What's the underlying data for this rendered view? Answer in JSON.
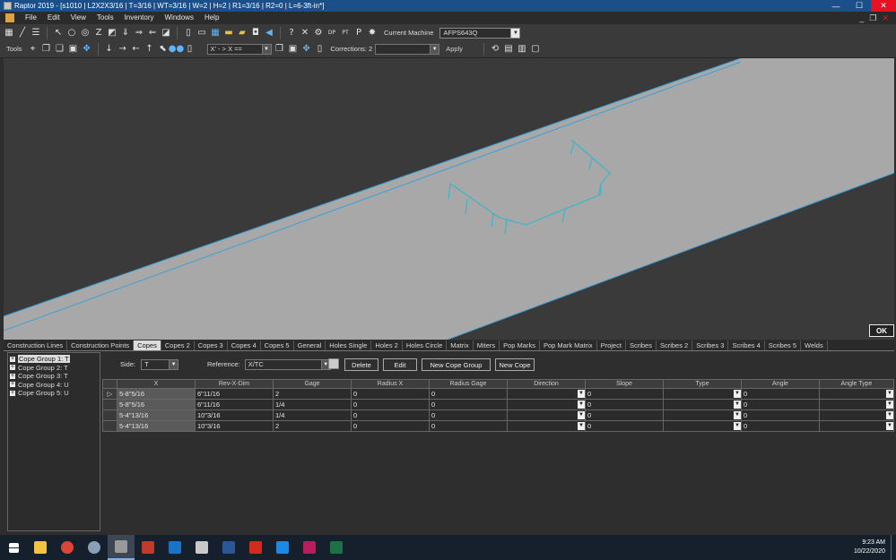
{
  "window": {
    "title": "Raptor 2019 - [s1010 | L2X2X3/16 | T=3/16 | WT=3/16 | W=2 | H=2 | R1=3/16 | R2=0 | L=6-3ft-in*]",
    "minimize_glyph": "—",
    "maximize_glyph": "☐",
    "close_glyph": "✕",
    "mdi_minimize_glyph": "_",
    "mdi_restore_glyph": "❐",
    "mdi_close_glyph": "✕"
  },
  "menu": [
    "File",
    "Edit",
    "View",
    "Tools",
    "Inventory",
    "Windows",
    "Help"
  ],
  "toolbar1": {
    "icons": [
      "grid-icon",
      "line-icon",
      "pointer-icon",
      "circle-icon",
      "target-icon",
      "z-icon",
      "square-icon",
      "arrow-down-icon",
      "arrow-right-icon",
      "arrow-left-icon",
      "box-icon",
      "new-icon",
      "open-icon",
      "folder-icon",
      "save-icon",
      "back-icon",
      "question-icon",
      "tools-icon",
      "gear-icon",
      "dp-tv-icon",
      "pt-icon",
      "burst-icon"
    ],
    "current_machine_label": "Current Machine",
    "current_machine_value": "AFPS643Q"
  },
  "toolbar2": {
    "tools_label": "Tools",
    "xfield_value": "X' - > X ==",
    "corrections_label": "Corrections: 2",
    "corrections_value": "",
    "apply_label": "Apply"
  },
  "canvas": {
    "beam_color": "#a8a8a8",
    "edge_color": "#3da0d6",
    "cope_color": "#38b6c9",
    "background": "#3a3a3a",
    "ok_label": "OK"
  },
  "tabs": [
    "Construction Lines",
    "Construction Points",
    "Copes",
    "Copes 2",
    "Copes 3",
    "Copes 4",
    "Copes 5",
    "General",
    "Holes Single",
    "Holes 2",
    "Holes Circle",
    "Matrix",
    "Miters",
    "Pop Marks",
    "Pop Mark Matrix",
    "Project",
    "Scribes",
    "Scribes 2",
    "Scribes 3",
    "Scribes 4",
    "Scribes 5",
    "Welds"
  ],
  "active_tab": "Copes",
  "tree": [
    "Cope Group 1: T",
    "Cope Group 2: T",
    "Cope Group 3: T",
    "Cope Group 4: U",
    "Cope Group 5: U"
  ],
  "controls": {
    "side_label": "Side:",
    "side_value": "T",
    "reference_label": "Reference:",
    "reference_value": "X/TC",
    "delete_label": "Delete",
    "edit_label": "Edit",
    "new_cope_group_label": "New Cope Group",
    "new_cope_label": "New Cope"
  },
  "grid": {
    "columns": [
      "X",
      "Rev-X-Dim",
      "Gage",
      "Radius X",
      "Radius Gage",
      "Direction",
      "Slope",
      "Type",
      "Angle",
      "Angle Type"
    ],
    "rows": [
      [
        "5-8\"5/16",
        "6\"11/16",
        "2",
        "0",
        "0",
        "",
        "0",
        "",
        "0",
        ""
      ],
      [
        "5-8\"5/16",
        "6\"11/16",
        "1/4",
        "0",
        "0",
        "",
        "0",
        "",
        "0",
        ""
      ],
      [
        "5-4\"13/16",
        "10\"3/16",
        "1/4",
        "0",
        "0",
        "",
        "0",
        "",
        "0",
        ""
      ],
      [
        "5-4\"13/16",
        "10\"3/16",
        "2",
        "0",
        "0",
        "",
        "0",
        "",
        "0",
        ""
      ]
    ],
    "row_indicator": "▷"
  },
  "taskbar": {
    "apps": [
      {
        "name": "start-icon",
        "color": "#ffffff"
      },
      {
        "name": "file-explorer-icon",
        "color": "#f3c342"
      },
      {
        "name": "chrome-icon",
        "color": "#db4437"
      },
      {
        "name": "tool-app-icon",
        "color": "#8aa0b8"
      },
      {
        "name": "raptor-app-icon",
        "color": "#9a9a9a"
      },
      {
        "name": "red-app-icon",
        "color": "#c0392b"
      },
      {
        "name": "outlook-icon",
        "color": "#1a73c8"
      },
      {
        "name": "calculator-icon",
        "color": "#c9c9c9"
      },
      {
        "name": "word-icon",
        "color": "#2b5797"
      },
      {
        "name": "acrobat-icon",
        "color": "#d52b1e"
      },
      {
        "name": "blue-app-icon",
        "color": "#1e88e5"
      },
      {
        "name": "p-app-icon",
        "color": "#b71c5c"
      },
      {
        "name": "excel-icon",
        "color": "#1e7145"
      }
    ],
    "time": "9:23 AM",
    "date": "10/22/2020"
  }
}
